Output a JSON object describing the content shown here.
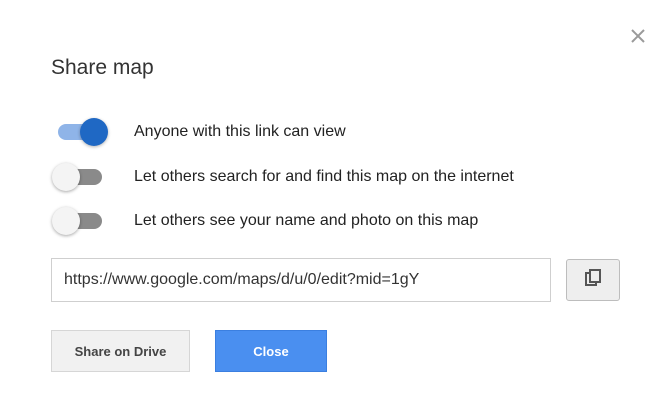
{
  "dialog": {
    "title": "Share map",
    "close_icon": "close-icon"
  },
  "toggles": [
    {
      "label": "Anyone with this link can view",
      "on": true
    },
    {
      "label": "Let others search for and find this map on the internet",
      "on": false
    },
    {
      "label": "Let others see your name and photo on this map",
      "on": false
    }
  ],
  "link": {
    "value": "https://www.google.com/maps/d/u/0/edit?mid=1gY",
    "copy_icon": "copy-icon"
  },
  "buttons": {
    "share_drive_label": "Share on Drive",
    "close_label": "Close"
  },
  "colors": {
    "toggle_on_knob": "#1f68c4",
    "toggle_on_track": "#8fb4e8",
    "toggle_off_track": "#8a8a8a",
    "primary_button": "#4a8ff0"
  }
}
